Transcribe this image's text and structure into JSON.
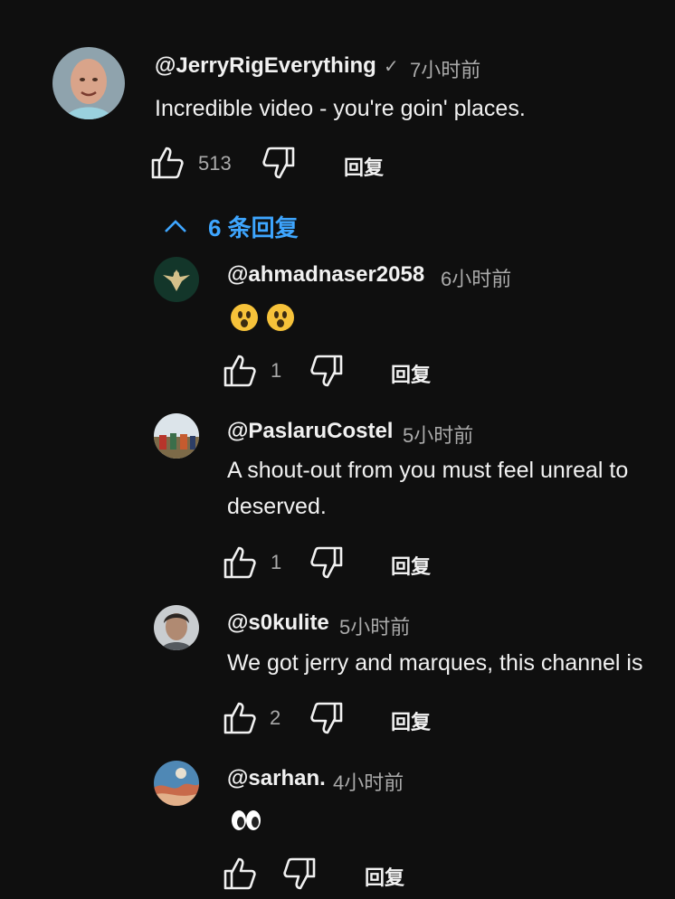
{
  "main_comment": {
    "author": "@JerryRigEverything",
    "verified_icon": "checkmark-icon",
    "time": "7小时前",
    "text": "Incredible video - you're goin' places.",
    "likes": "513",
    "reply_label": "回复"
  },
  "replies_toggle": {
    "label": "6 条回复",
    "icon": "chevron-up-icon"
  },
  "replies": [
    {
      "author": "@ahmadnaser2058",
      "time": "6小时前",
      "text_emoji": "astonished-face-emoji x2",
      "likes": "1",
      "reply_label": "回复"
    },
    {
      "author": "@PaslaruCostel",
      "time": "5小时前",
      "text_line1": "A shout-out from you must feel unreal to",
      "text_line2": "deserved.",
      "likes": "1",
      "reply_label": "回复"
    },
    {
      "author": "@s0kulite",
      "time": "5小时前",
      "text": "We got jerry and marques, this channel is",
      "likes": "2",
      "reply_label": "回复"
    },
    {
      "author": "@sarhan.",
      "time": "4小时前",
      "text_emoji": "eyes-emoji",
      "likes": "",
      "reply_label": "回复"
    }
  ],
  "colors": {
    "background": "#0f0f0f",
    "link": "#3ea6ff",
    "secondary": "#aaaaaa",
    "primary": "#f1f1f1"
  }
}
